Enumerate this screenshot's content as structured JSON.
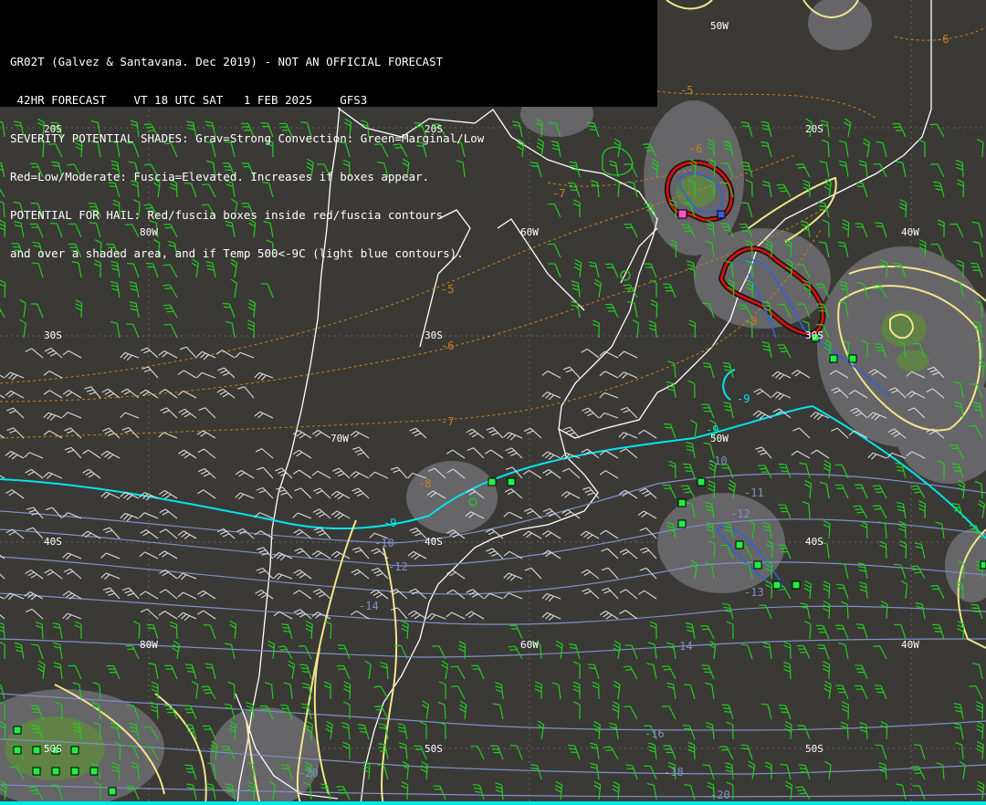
{
  "header": {
    "line1": "GR02T (Galvez & Santavana. Dec 2019) - NOT AN OFFICIAL FORECAST",
    "line2": " 42HR FORECAST    VT 18 UTC SAT   1 FEB 2025    GFS3",
    "line3": "SEVERITY POTENTIAL SHADES: Grav=Strong Convection: Green=Marginal/Low",
    "line4": "Red=Low/Moderate: Fuscia=Elevated. Increases if boxes appear.",
    "line5": "POTENTIAL FOR HAIL: Red/fuscia boxes inside red/fuscia contours",
    "line6": "and over a shaded area, and if Temp 500<-9C (light blue contours)."
  },
  "grid_labels": {
    "lon_50w_top": "50W",
    "lat_20s_left": "20S",
    "lat_20s_mid": "20S",
    "lat_20s_right": "20S",
    "lon_80w_a": "80W",
    "lon_60w_a": "60W",
    "lon_40w_a": "40W",
    "lat_30s_left": "30S",
    "lat_30s_mid": "30S",
    "lat_30s_right": "30S",
    "lon_70w": "70W",
    "lon_50w_mid": "50W",
    "lat_40s_left": "40S",
    "lat_40s_mid": "40S",
    "lat_40s_right": "40S",
    "lon_80w_b": "80W",
    "lon_60w_b": "60W",
    "lon_40w_b": "40W",
    "lat_50s_left": "50S",
    "lat_50s_mid": "50S",
    "lat_50s_right": "50S"
  },
  "contour_labels": {
    "t500_a": "-5",
    "t500_b": "-6",
    "t500_c": "-6",
    "t500_d": "-7",
    "t500_e": "-5",
    "t500_f": "-6",
    "t500_g": "-7",
    "t500_h": "-8",
    "t500_i": "-8",
    "t500_j": "-9",
    "t500_k": "-9",
    "t500_l": "-9",
    "t500_m": "-10",
    "t500_n": "-10",
    "t500_o": "-11",
    "t500_p": "-12",
    "t500_q": "-12",
    "t500_r": "-13",
    "t500_s": "-14",
    "t500_t": "-14",
    "t500_u": "-16",
    "t500_v": "-18",
    "t500_w": "-20",
    "t500_x": "-20"
  },
  "colors": {
    "background": "#3a3935",
    "coastline": "#ffffff",
    "gray_shade": "#8a8a92",
    "green_shade": "#5f8a3e",
    "yellow_contour": "#f0e68c",
    "cyan_contour": "#00e5ee",
    "blue_contour": "#7f8fc8",
    "red_contour": "#d01010",
    "orange_contour": "#c8801e",
    "wind_barb_green": "#22cc22",
    "wind_barb_white": "#dcdcdc",
    "box_green": "#22ee44",
    "box_fuscia": "#ff55cc"
  },
  "legend": {
    "hail_boxes": "green squares",
    "elevated": "fuscia square"
  }
}
